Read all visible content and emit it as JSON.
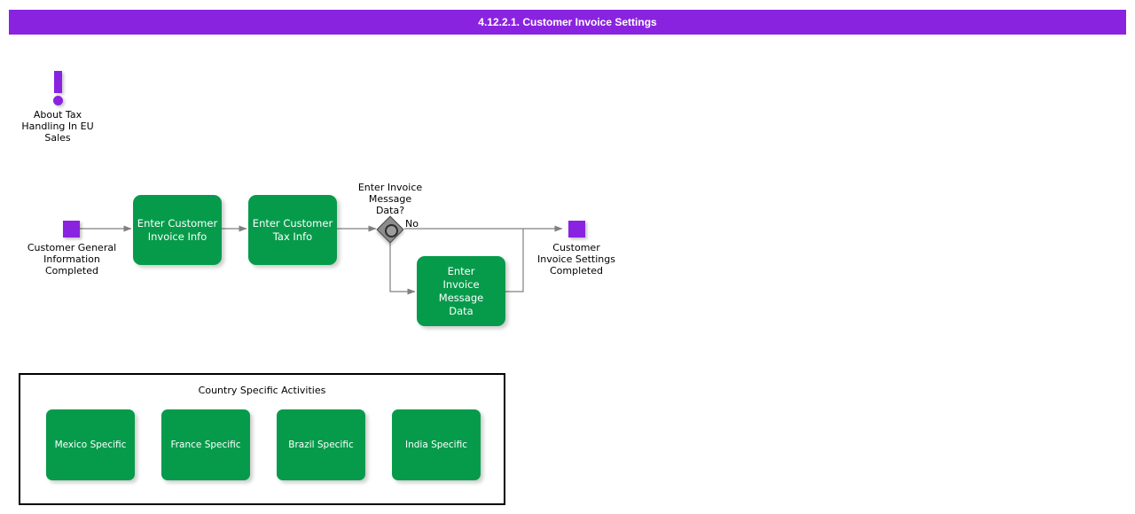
{
  "header": {
    "title": "4.12.2.1. Customer Invoice Settings",
    "bar_color": "#8a23e0",
    "text_color": "#ffffff"
  },
  "theme": {
    "task_fill": "#069b4b",
    "task_text": "#ffffff",
    "event_fill": "#8a23e0",
    "gateway_fill": "#8c8c8c",
    "connector_color": "#808080",
    "group_border": "#000000",
    "canvas": "#ffffff"
  },
  "annotation": {
    "icon": "exclamation-mark-icon",
    "label": "About Tax\nHandling In\nEU Sales"
  },
  "diagram": {
    "type": "bpmn-process-flow",
    "start_event": {
      "name": "customer-general-information-completed",
      "label": "Customer General\nInformation\nCompleted",
      "shape": "square",
      "color": "#8a23e0"
    },
    "end_event": {
      "name": "customer-invoice-settings-completed",
      "label": "Customer\nInvoice Settings\nCompleted",
      "shape": "square",
      "color": "#8a23e0"
    },
    "tasks": [
      {
        "id": "enter-customer-invoice-info",
        "label": "Enter Customer\nInvoice Info"
      },
      {
        "id": "enter-customer-tax-info",
        "label": "Enter Customer\nTax Info"
      },
      {
        "id": "enter-invoice-message-data",
        "label": "Enter\nInvoice\nMessage\nData"
      }
    ],
    "gateway": {
      "id": "enter-invoice-message-data-gateway",
      "label": "Enter Invoice\nMessage\nData?",
      "type": "inclusive",
      "branches": [
        {
          "label": "No",
          "target": "customer-invoice-settings-completed"
        },
        {
          "label": "",
          "target": "enter-invoice-message-data"
        }
      ]
    }
  },
  "country_group": {
    "title": "Country Specific Activities",
    "tasks": [
      {
        "id": "mexico-specific",
        "label": "Mexico Specific"
      },
      {
        "id": "france-specific",
        "label": "France Specific"
      },
      {
        "id": "brazil-specific",
        "label": "Brazil Specific"
      },
      {
        "id": "india-specific",
        "label": "India Specific"
      }
    ]
  }
}
